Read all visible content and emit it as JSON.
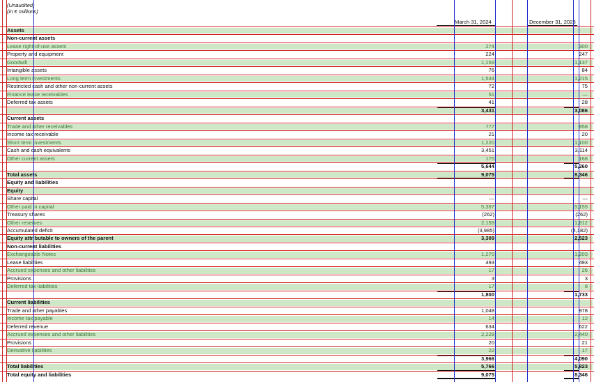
{
  "notes": {
    "unaudited": "(Unaudited)",
    "units": "(in € millions)"
  },
  "columns": {
    "current": "March 31, 2024",
    "prior": "December 31, 2023"
  },
  "rows": [
    {
      "label": "Assets",
      "bold": true,
      "shade": true
    },
    {
      "label": "Non-current assets",
      "bold": true
    },
    {
      "label": "Lease right-of-use assets",
      "v1": "274",
      "v2": "300",
      "shade": true
    },
    {
      "label": "Property and equipment",
      "v1": "224",
      "v2": "247"
    },
    {
      "label": "Goodwill",
      "v1": "1,159",
      "v2": "1,137",
      "shade": true
    },
    {
      "label": "Intangible assets",
      "v1": "76",
      "v2": "84"
    },
    {
      "label": "Long term investments",
      "v1": "1,534",
      "v2": "1,215",
      "shade": true
    },
    {
      "label": "Restricted cash and other non-current assets",
      "v1": "72",
      "v2": "75"
    },
    {
      "label": "Finance lease receivables",
      "v1": "51",
      "v2": "—",
      "shade": true
    },
    {
      "label": "Deferred tax assets",
      "v1": "41",
      "v2": "28"
    },
    {
      "label": "",
      "v1": "3,431",
      "v2": "3,086",
      "bold": true,
      "shade": true
    },
    {
      "label": "Current assets",
      "bold": true
    },
    {
      "label": "Trade and other receivables",
      "v1": "777",
      "v2": "858",
      "shade": true
    },
    {
      "label": "Income tax receivable",
      "v1": "21",
      "v2": "20"
    },
    {
      "label": "Short term investments",
      "v1": "1,220",
      "v2": "1,100",
      "shade": true
    },
    {
      "label": "Cash and cash equivalents",
      "v1": "3,451",
      "v2": "3,114"
    },
    {
      "label": "Other current assets",
      "v1": "175",
      "v2": "168",
      "shade": true
    },
    {
      "label": "",
      "v1": "5,644",
      "v2": "5,260",
      "bold": true
    },
    {
      "label": "Total assets",
      "v1": "9,075",
      "v2": "8,346",
      "bold": true,
      "shade": true
    },
    {
      "label": "Equity and liabilities",
      "bold": true
    },
    {
      "label": "Equity",
      "bold": true,
      "shade": true
    },
    {
      "label": "Share capital",
      "v1": "—",
      "v2": "—"
    },
    {
      "label": "Other paid in capital",
      "v1": "5,397",
      "v2": "5,155",
      "shade": true
    },
    {
      "label": "Treasury shares",
      "v1": "(262)",
      "v2": "(262)"
    },
    {
      "label": "Other reserves",
      "v1": "2,159",
      "v2": "1,812",
      "shade": true
    },
    {
      "label": "Accumulated deficit",
      "v1": "(3,985)",
      "v2": "(4,182)"
    },
    {
      "label": "Equity attributable to owners of the parent",
      "v1": "3,309",
      "v2": "2,523",
      "bold": true,
      "shade": true
    },
    {
      "label": "Non-current liabilities",
      "bold": true
    },
    {
      "label": "Exchangeable Notes",
      "v1": "1,270",
      "v2": "1,203",
      "shade": true
    },
    {
      "label": "Lease liabilities",
      "v1": "493",
      "v2": "493"
    },
    {
      "label": "Accrued expenses and other liabilities",
      "v1": "17",
      "v2": "26",
      "shade": true
    },
    {
      "label": "Provisions",
      "v1": "3",
      "v2": "3"
    },
    {
      "label": "Deferred tax liabilities",
      "v1": "17",
      "v2": "8",
      "shade": true
    },
    {
      "label": "",
      "v1": "1,800",
      "v2": "1,733",
      "bold": true
    },
    {
      "label": "Current liabilities",
      "bold": true,
      "shade": true
    },
    {
      "label": "Trade and other payables",
      "v1": "1,048",
      "v2": "978"
    },
    {
      "label": "Income tax payable",
      "v1": "14",
      "v2": "12",
      "shade": true
    },
    {
      "label": "Deferred revenue",
      "v1": "634",
      "v2": "622"
    },
    {
      "label": "Accrued expenses and other liabilities",
      "v1": "2,228",
      "v2": "2,440",
      "shade": true
    },
    {
      "label": "Provisions",
      "v1": "20",
      "v2": "21"
    },
    {
      "label": "Derivative liabilities",
      "v1": "22",
      "v2": "17",
      "shade": true
    },
    {
      "label": "",
      "v1": "3,966",
      "v2": "4,090",
      "bold": true
    },
    {
      "label": "Total liabilities",
      "v1": "5,766",
      "v2": "5,823",
      "bold": true,
      "shade": true
    },
    {
      "label": "Total equity and liabilities",
      "v1": "9,075",
      "v2": "8,346",
      "bold": true
    }
  ]
}
